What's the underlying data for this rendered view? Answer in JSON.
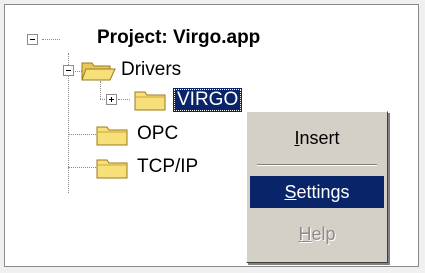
{
  "tree": {
    "root": {
      "label": "Project: Virgo.app"
    },
    "drivers": {
      "label": "Drivers"
    },
    "virgo": {
      "label": "VIRGO"
    },
    "opc": {
      "label": "OPC"
    },
    "tcpip": {
      "label": "TCP/IP"
    }
  },
  "context_menu": {
    "insert": {
      "accel": "I",
      "rest": "nsert"
    },
    "settings": {
      "accel": "S",
      "rest": "ettings"
    },
    "help": {
      "accel": "H",
      "rest": "elp"
    }
  },
  "colors": {
    "selection": "#0a246a",
    "folder_fill": "#f7e07a",
    "folder_edge": "#9a7a1a",
    "menu_bg": "#d4d0c8",
    "disabled_text": "#8e8c86"
  },
  "icons": {
    "collapse": "minus-box",
    "expand": "plus-box",
    "folder_open": "open-folder",
    "folder_closed": "closed-folder"
  }
}
